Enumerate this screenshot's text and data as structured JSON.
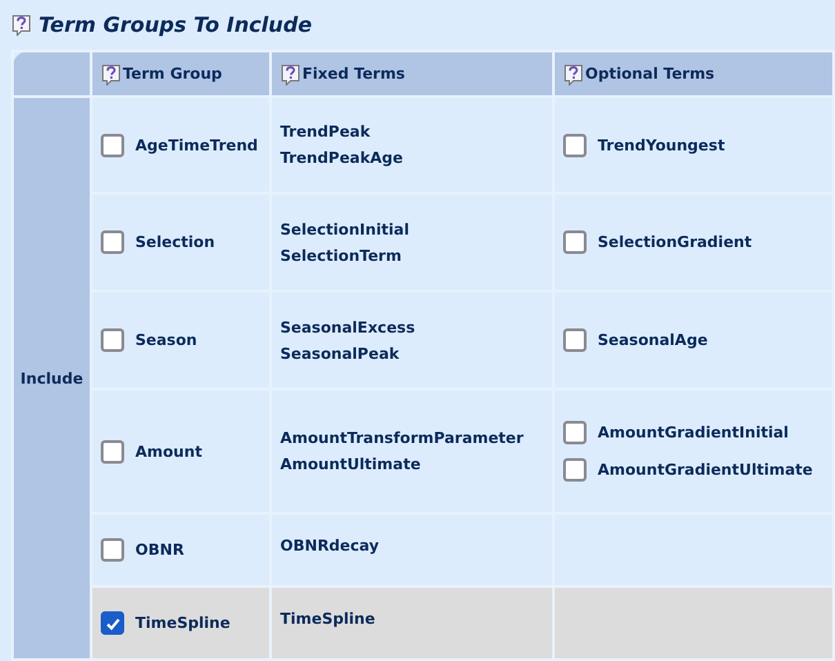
{
  "title": "Term Groups To Include",
  "columns": [
    "Term Group",
    "Fixed Terms",
    "Optional Terms"
  ],
  "row_header": "Include",
  "groups": [
    {
      "name": "AgeTimeTrend",
      "checked": false,
      "fixed_terms": [
        "TrendPeak",
        "TrendPeakAge"
      ],
      "optional_terms": [
        {
          "name": "TrendYoungest",
          "checked": false
        }
      ]
    },
    {
      "name": "Selection",
      "checked": false,
      "fixed_terms": [
        "SelectionInitial",
        "SelectionTerm"
      ],
      "optional_terms": [
        {
          "name": "SelectionGradient",
          "checked": false
        }
      ]
    },
    {
      "name": "Season",
      "checked": false,
      "fixed_terms": [
        "SeasonalExcess",
        "SeasonalPeak"
      ],
      "optional_terms": [
        {
          "name": "SeasonalAge",
          "checked": false
        }
      ]
    },
    {
      "name": "Amount",
      "checked": false,
      "fixed_terms": [
        "AmountTransformParameter",
        "AmountUltimate"
      ],
      "optional_terms": [
        {
          "name": "AmountGradientInitial",
          "checked": false
        },
        {
          "name": "AmountGradientUltimate",
          "checked": false
        }
      ]
    },
    {
      "name": "OBNR",
      "checked": false,
      "fixed_terms": [
        "OBNRdecay"
      ]
    },
    {
      "name": "TimeSpline",
      "checked": true,
      "fixed_terms": [
        "TimeSpline"
      ]
    }
  ]
}
